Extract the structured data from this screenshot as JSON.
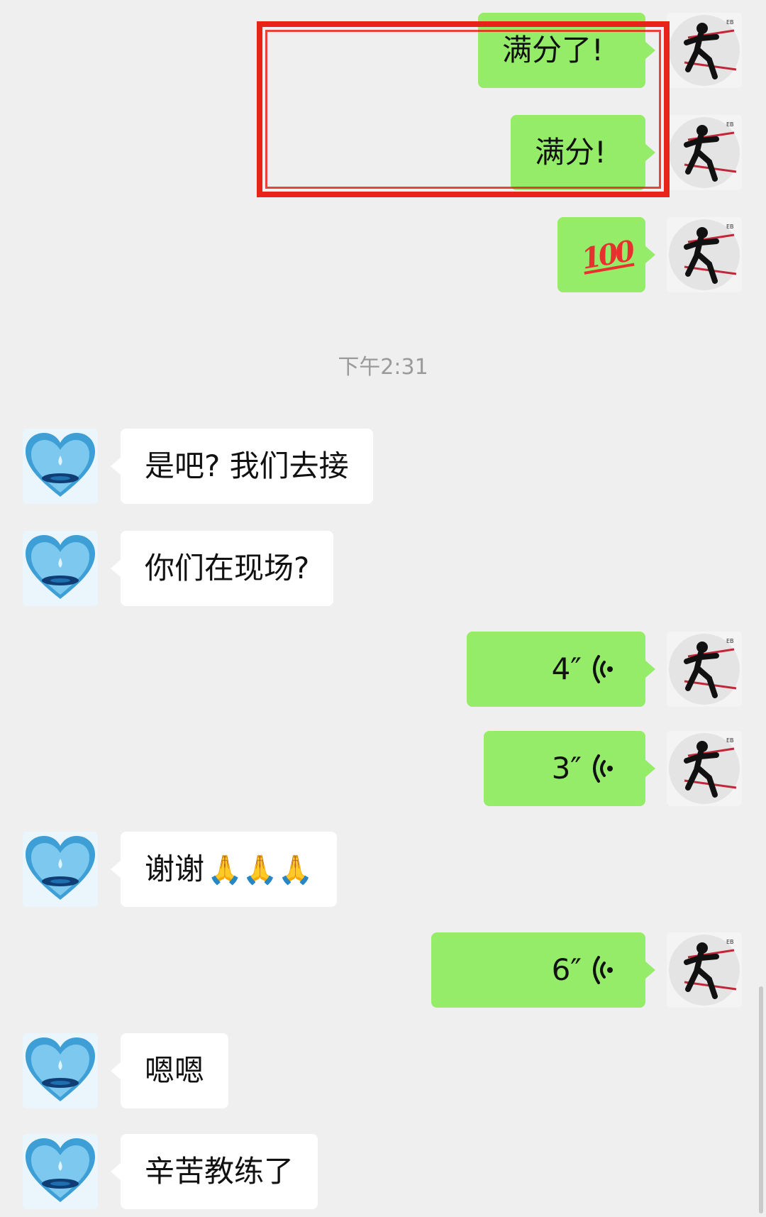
{
  "chat": {
    "timestamp": "下午2:31",
    "messages": [
      {
        "side": "right",
        "type": "text",
        "text": "满分了!"
      },
      {
        "side": "right",
        "type": "text",
        "text": "满分!"
      },
      {
        "side": "right",
        "type": "emoji",
        "text": "100"
      },
      {
        "side": "left",
        "type": "text",
        "text": "是吧? 我们去接"
      },
      {
        "side": "left",
        "type": "text",
        "text": "你们在现场?"
      },
      {
        "side": "right",
        "type": "voice",
        "duration": "4″"
      },
      {
        "side": "right",
        "type": "voice",
        "duration": "3″"
      },
      {
        "side": "left",
        "type": "text",
        "text": "谢谢",
        "emoji": "🙏🙏🙏"
      },
      {
        "side": "right",
        "type": "voice",
        "duration": "6″"
      },
      {
        "side": "left",
        "type": "text",
        "text": "嗯嗯"
      },
      {
        "side": "left",
        "type": "text",
        "text": "辛苦教练了"
      }
    ]
  },
  "icons": {
    "right_avatar": "runner-avatar-icon",
    "left_avatar": "blue-heart-water-drop-avatar-icon",
    "voice": "voice-wave-icon"
  },
  "colors": {
    "background": "#efefef",
    "sent_bubble": "#95ec69",
    "received_bubble": "#ffffff",
    "highlight_box": "#e8231a"
  }
}
